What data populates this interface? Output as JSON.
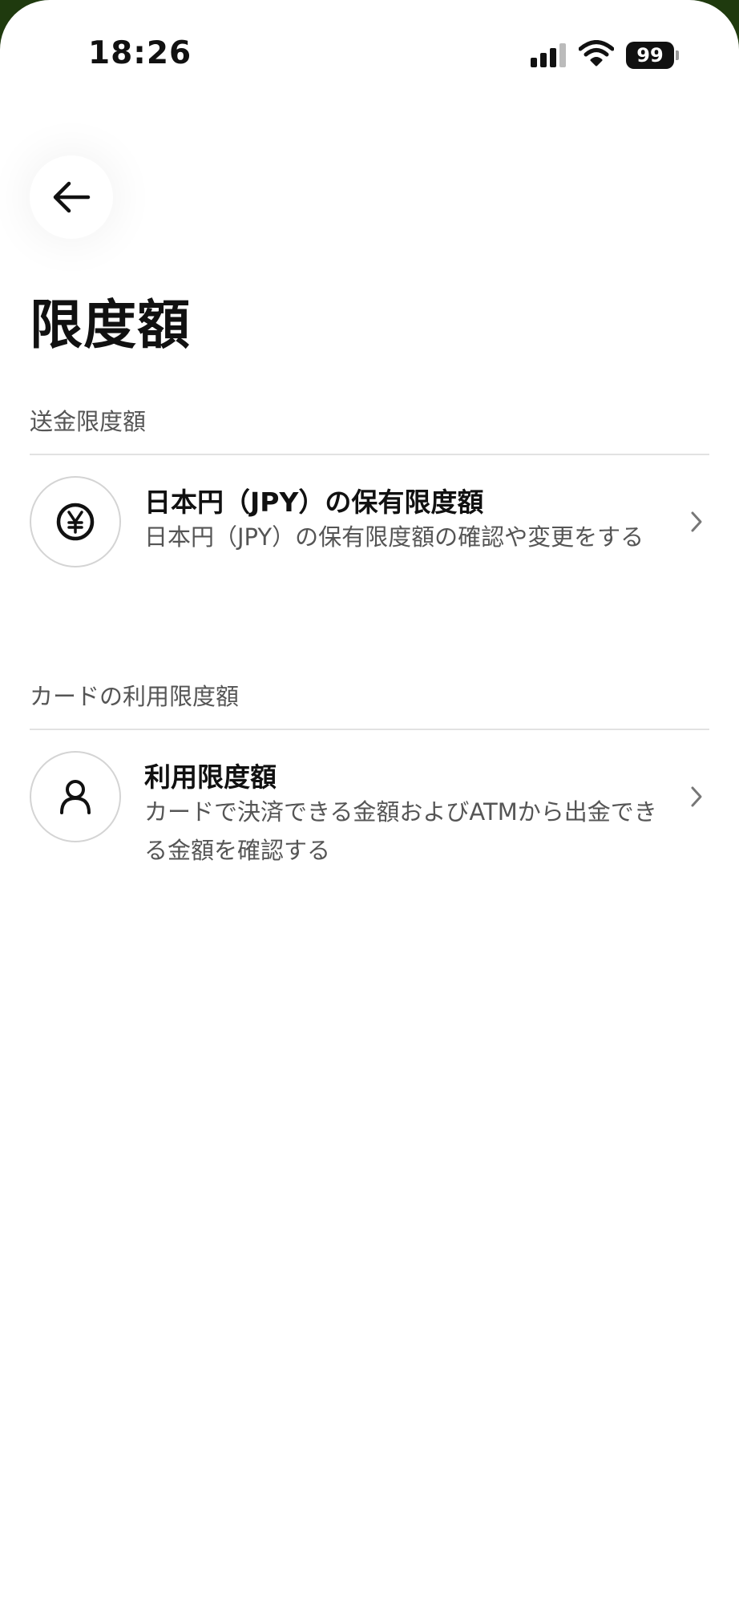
{
  "status_bar": {
    "time": "18:26",
    "battery": "99",
    "icons": [
      "signal-icon",
      "wifi-icon",
      "battery-icon"
    ]
  },
  "header": {
    "back_icon": "arrow-left-icon",
    "title": "限度額"
  },
  "sections": [
    {
      "label": "送金限度額",
      "items": [
        {
          "icon": "yen-circle-icon",
          "title": "日本円（JPY）の保有限度額",
          "description": "日本円（JPY）の保有限度額の確認や変更をする"
        }
      ]
    },
    {
      "label": "カードの利用限度額",
      "items": [
        {
          "icon": "person-icon",
          "title": "利用限度額",
          "description": "カードで決済できる金額およびATMから出金できる金額を確認する"
        }
      ]
    }
  ],
  "colors": {
    "background": "#ffffff",
    "frame": "#1f3a0e",
    "text_primary": "#111111",
    "text_secondary": "#555555",
    "divider": "#e2e2e2"
  }
}
